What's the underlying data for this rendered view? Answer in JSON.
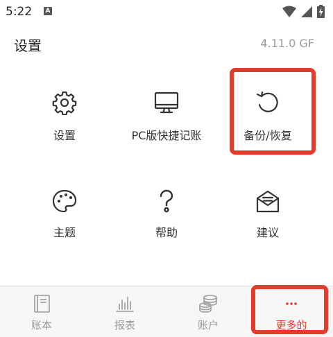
{
  "status_bar": {
    "time": "5:22",
    "notification_badge": "A",
    "icons": [
      "wifi-icon",
      "signal-icon",
      "battery-charging-icon"
    ]
  },
  "header": {
    "title": "设置",
    "version": "4.11.0 GF"
  },
  "grid": {
    "items": [
      {
        "label": "设置",
        "icon": "gear-icon"
      },
      {
        "label": "PC版快捷记账",
        "icon": "monitor-icon"
      },
      {
        "label": "备份/恢复",
        "icon": "restore-icon"
      },
      {
        "label": "主题",
        "icon": "palette-icon"
      },
      {
        "label": "帮助",
        "icon": "help-icon"
      },
      {
        "label": "建议",
        "icon": "feedback-mail-icon"
      }
    ]
  },
  "bottom_nav": {
    "items": [
      {
        "label": "账本",
        "icon": "book-icon",
        "active": false
      },
      {
        "label": "报表",
        "icon": "bar-chart-icon",
        "active": false
      },
      {
        "label": "账户",
        "icon": "coins-icon",
        "active": false
      },
      {
        "label": "更多的",
        "icon": "more-dots-icon",
        "active": true
      }
    ]
  },
  "colors": {
    "accent": "#e53b2c",
    "muted_text": "#9a9a9a",
    "icon_stroke": "#333333",
    "nav_icon": "#a5a5a5"
  }
}
